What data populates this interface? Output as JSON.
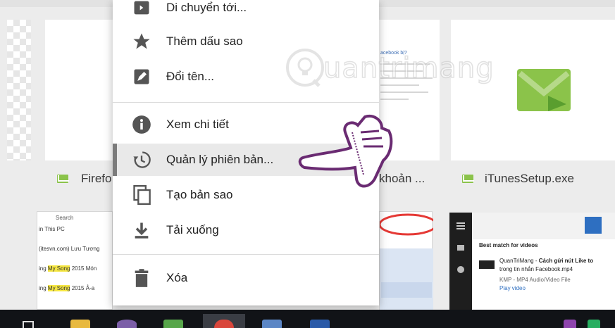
{
  "context_menu": {
    "items": [
      {
        "label": "Di chuyển tới...",
        "icon": "move-to-icon"
      },
      {
        "label": "Thêm dấu sao",
        "icon": "star-icon"
      },
      {
        "label": "Đổi tên...",
        "icon": "rename-icon"
      },
      {
        "label": "Xem chi tiết",
        "icon": "info-icon"
      },
      {
        "label": "Quản lý phiên bản...",
        "icon": "history-icon",
        "highlighted": true
      },
      {
        "label": "Tạo bản sao",
        "icon": "copy-icon"
      },
      {
        "label": "Tải xuống",
        "icon": "download-icon"
      },
      {
        "label": "Xóa",
        "icon": "trash-icon"
      }
    ]
  },
  "files": {
    "firefox_label": "Firefo",
    "middle_label": "khoản ...",
    "middle_doc_title": "acebook bị?",
    "itunes_label": "iTunesSetup.exe"
  },
  "explorer_preview": {
    "search_label": "Search",
    "path_label": "in This PC",
    "rows": [
      {
        "prefix": "(itesvn.com) Lưu Tương",
        "hl": "",
        "suffix": ""
      },
      {
        "prefix": "ing ",
        "hl": "My Song",
        "suffix": " 2015 Món"
      },
      {
        "prefix": "ing ",
        "hl": "My Song",
        "suffix": " 2015 Ả-a"
      }
    ]
  },
  "cortana_preview": {
    "heading": "Best match for videos",
    "title_prefix": "QuanTriMang - ",
    "title_bold": "Cách gửi nút Like to",
    "title_line2": "trong tin nhắn Facebook.mp4",
    "meta": "KMP - MP4 Audio/Video File",
    "action": "Play video"
  },
  "watermark": {
    "text": "uantrimang"
  },
  "colors": {
    "accent_green": "#8bc34a",
    "menu_highlight": "#e9e9e9",
    "taskbar": "#111317"
  }
}
